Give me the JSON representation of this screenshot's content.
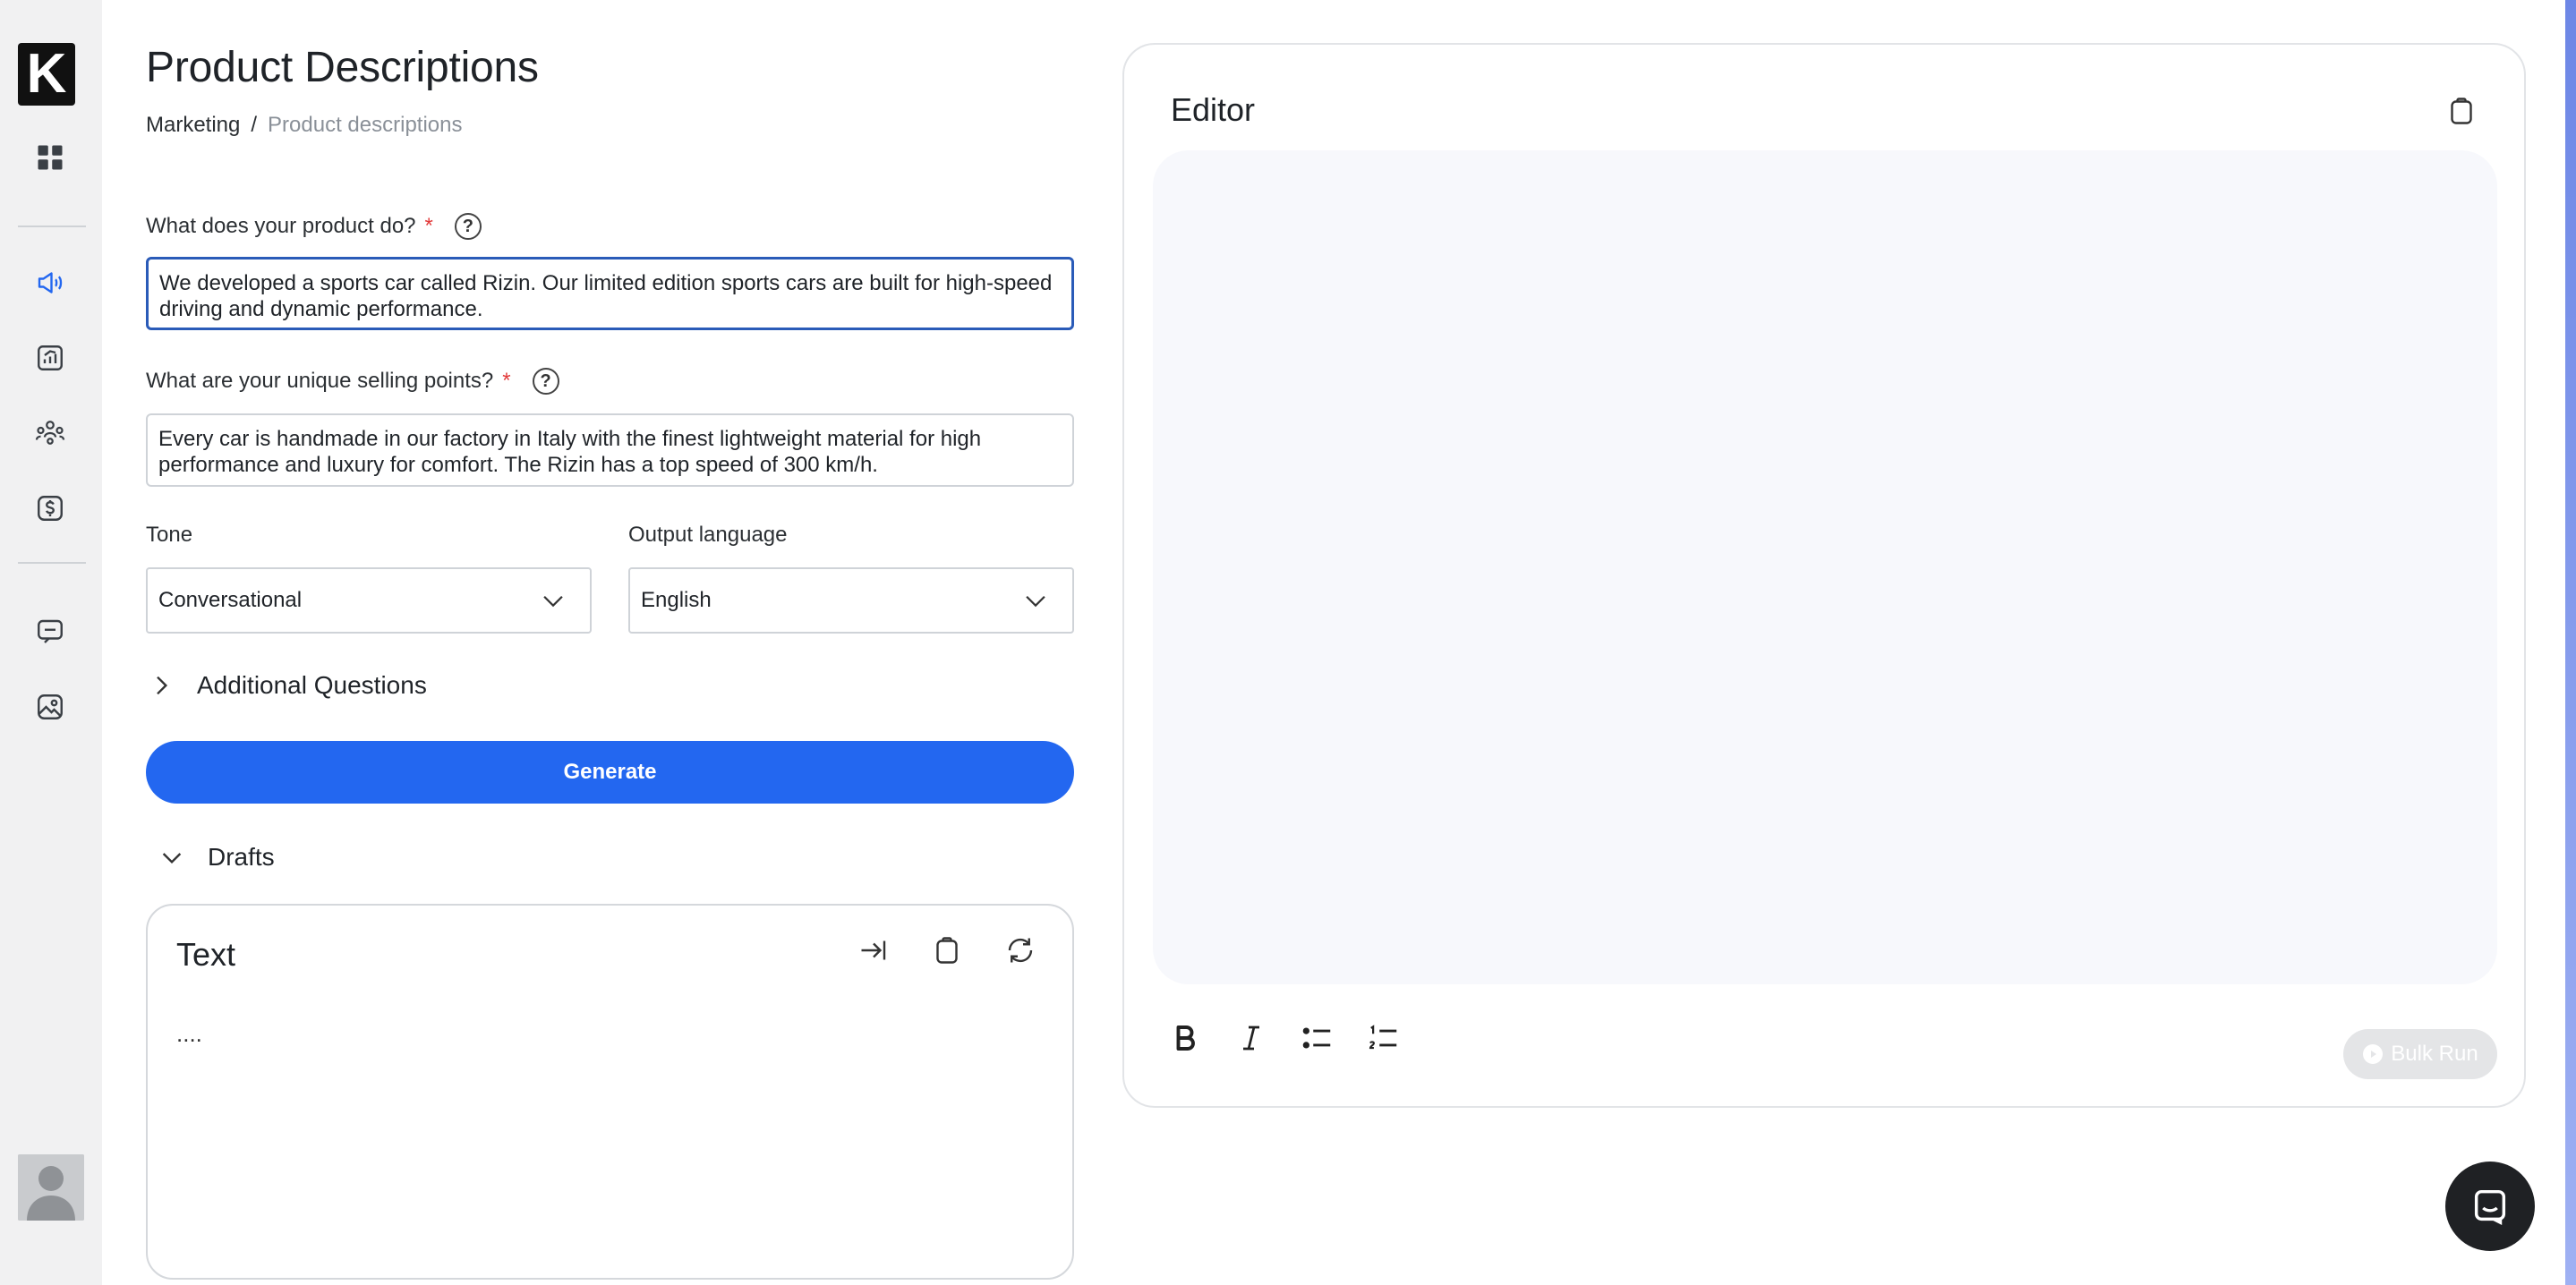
{
  "app": {
    "logo_letter": "K"
  },
  "header": {
    "title": "Product Descriptions",
    "breadcrumb": [
      "Marketing",
      "/",
      "Product descriptions"
    ]
  },
  "form": {
    "q1": {
      "label": "What does your product do?",
      "required_mark": "*",
      "help": "?",
      "value": "We developed a sports car called Rizin. Our limited edition sports cars are built for high-speed driving and dynamic performance."
    },
    "q2": {
      "label": "What are your unique selling points?",
      "required_mark": "*",
      "help": "?",
      "value": "Every car is handmade in our factory in Italy with the finest lightweight material for high performance and luxury for comfort. The Rizin has a top speed of 300 km/h."
    },
    "tone": {
      "label": "Tone",
      "value": "Conversational"
    },
    "language": {
      "label": "Output language",
      "value": "English"
    },
    "additional_questions": "Additional Questions",
    "generate_label": "Generate"
  },
  "drafts": {
    "label": "Drafts",
    "card": {
      "title": "Text",
      "body": "...."
    }
  },
  "editor": {
    "title": "Editor",
    "bulk_run_label": "Bulk Run"
  },
  "colors": {
    "accent": "#2367f0",
    "sidebar_bg": "#f1f1f2",
    "required": "#e23a3a"
  }
}
